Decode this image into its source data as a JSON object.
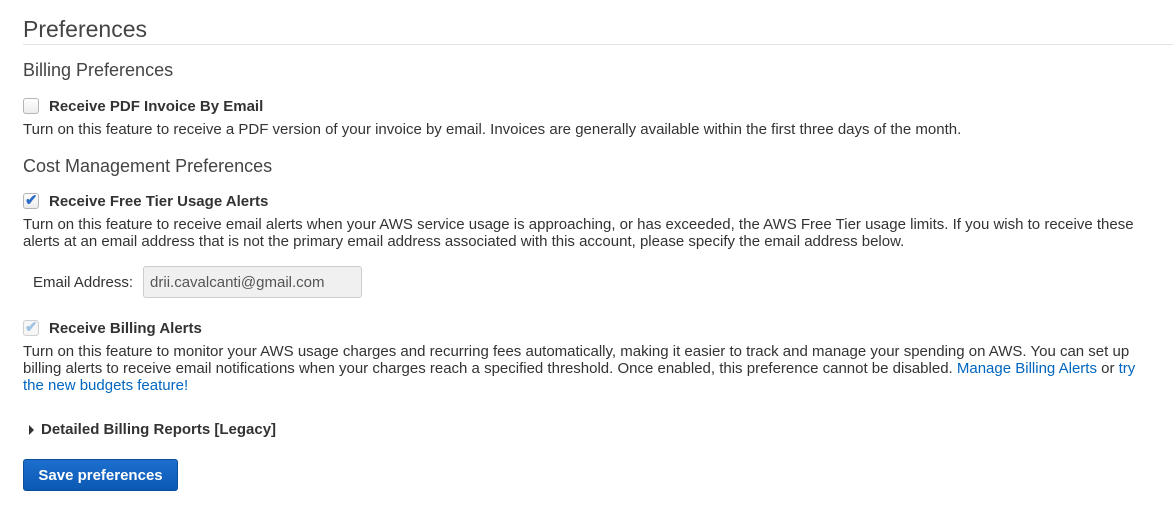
{
  "page": {
    "title": "Preferences"
  },
  "billing": {
    "title": "Billing Preferences",
    "pdf_invoice": {
      "label": "Receive PDF Invoice By Email",
      "checked": false,
      "description": "Turn on this feature to receive a PDF version of your invoice by email. Invoices are generally available within the first three days of the month."
    }
  },
  "cost": {
    "title": "Cost Management Preferences",
    "free_tier": {
      "label": "Receive Free Tier Usage Alerts",
      "checked": true,
      "description": "Turn on this feature to receive email alerts when your AWS service usage is approaching, or has exceeded, the AWS Free Tier usage limits. If you wish to receive these alerts at an email address that is not the primary email address associated with this account, please specify the email address below.",
      "email_label": "Email Address:",
      "email_value": "drii.cavalcanti@gmail.com"
    },
    "billing_alerts": {
      "label": "Receive Billing Alerts",
      "checked": true,
      "disabled": true,
      "description_part1": "Turn on this feature to monitor your AWS usage charges and recurring fees automatically, making it easier to track and manage your spending on AWS. You can set up billing alerts to receive email notifications when your charges reach a specified threshold. Once enabled, this preference cannot be disabled. ",
      "manage_link": "Manage Billing Alerts",
      "or_text": " or ",
      "budgets_link": "try the new budgets feature!"
    }
  },
  "detailed_reports": {
    "label": "Detailed Billing Reports [Legacy]"
  },
  "actions": {
    "save_label": "Save preferences"
  },
  "icons": {
    "checkmark": "checkmark-icon",
    "caret": "caret-right-icon"
  },
  "colors": {
    "link": "#0066c0",
    "primary_button": "#1266c4",
    "check": "#2b6cc4"
  }
}
